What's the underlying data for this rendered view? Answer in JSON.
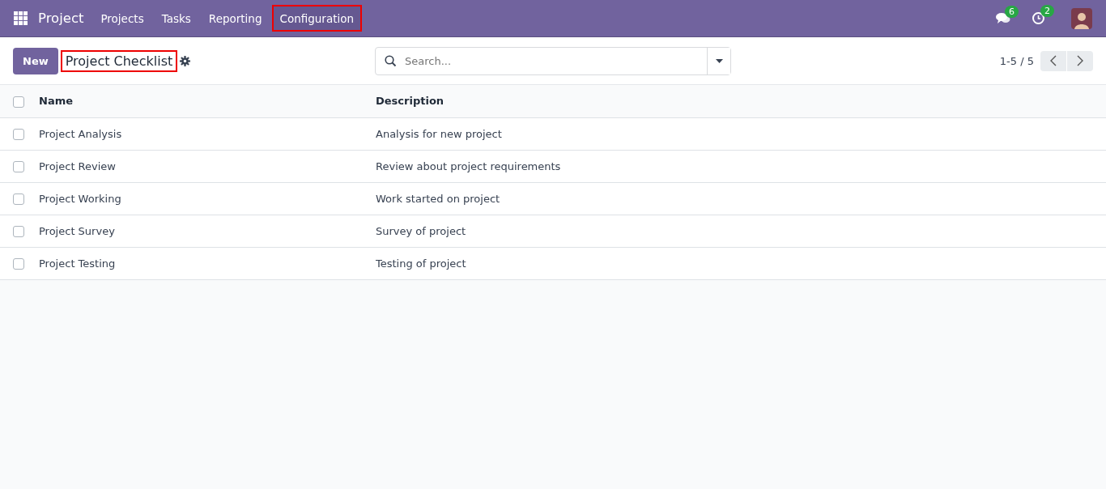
{
  "navbar": {
    "app_name": "Project",
    "menu": [
      {
        "label": "Projects",
        "selected": false,
        "highlighted": false
      },
      {
        "label": "Tasks",
        "selected": false,
        "highlighted": false
      },
      {
        "label": "Reporting",
        "selected": false,
        "highlighted": false
      },
      {
        "label": "Configuration",
        "selected": true,
        "highlighted": true
      }
    ],
    "messages_count": "6",
    "activities_count": "2"
  },
  "control_panel": {
    "new_button": "New",
    "title": "Project Checklist",
    "title_highlighted": true,
    "search": {
      "placeholder": "Search..."
    },
    "pager": "1-5 / 5"
  },
  "table": {
    "columns": [
      "Name",
      "Description"
    ],
    "all_checked": false,
    "rows": [
      {
        "checked": false,
        "cells": [
          "Project Analysis",
          "Analysis for new project"
        ]
      },
      {
        "checked": false,
        "cells": [
          "Project Review",
          "Review about project requirements"
        ]
      },
      {
        "checked": false,
        "cells": [
          "Project Working",
          "Work started on project"
        ]
      },
      {
        "checked": false,
        "cells": [
          "Project Survey",
          "Survey of project"
        ]
      },
      {
        "checked": false,
        "cells": [
          "Project Testing",
          "Testing of project"
        ]
      }
    ]
  }
}
